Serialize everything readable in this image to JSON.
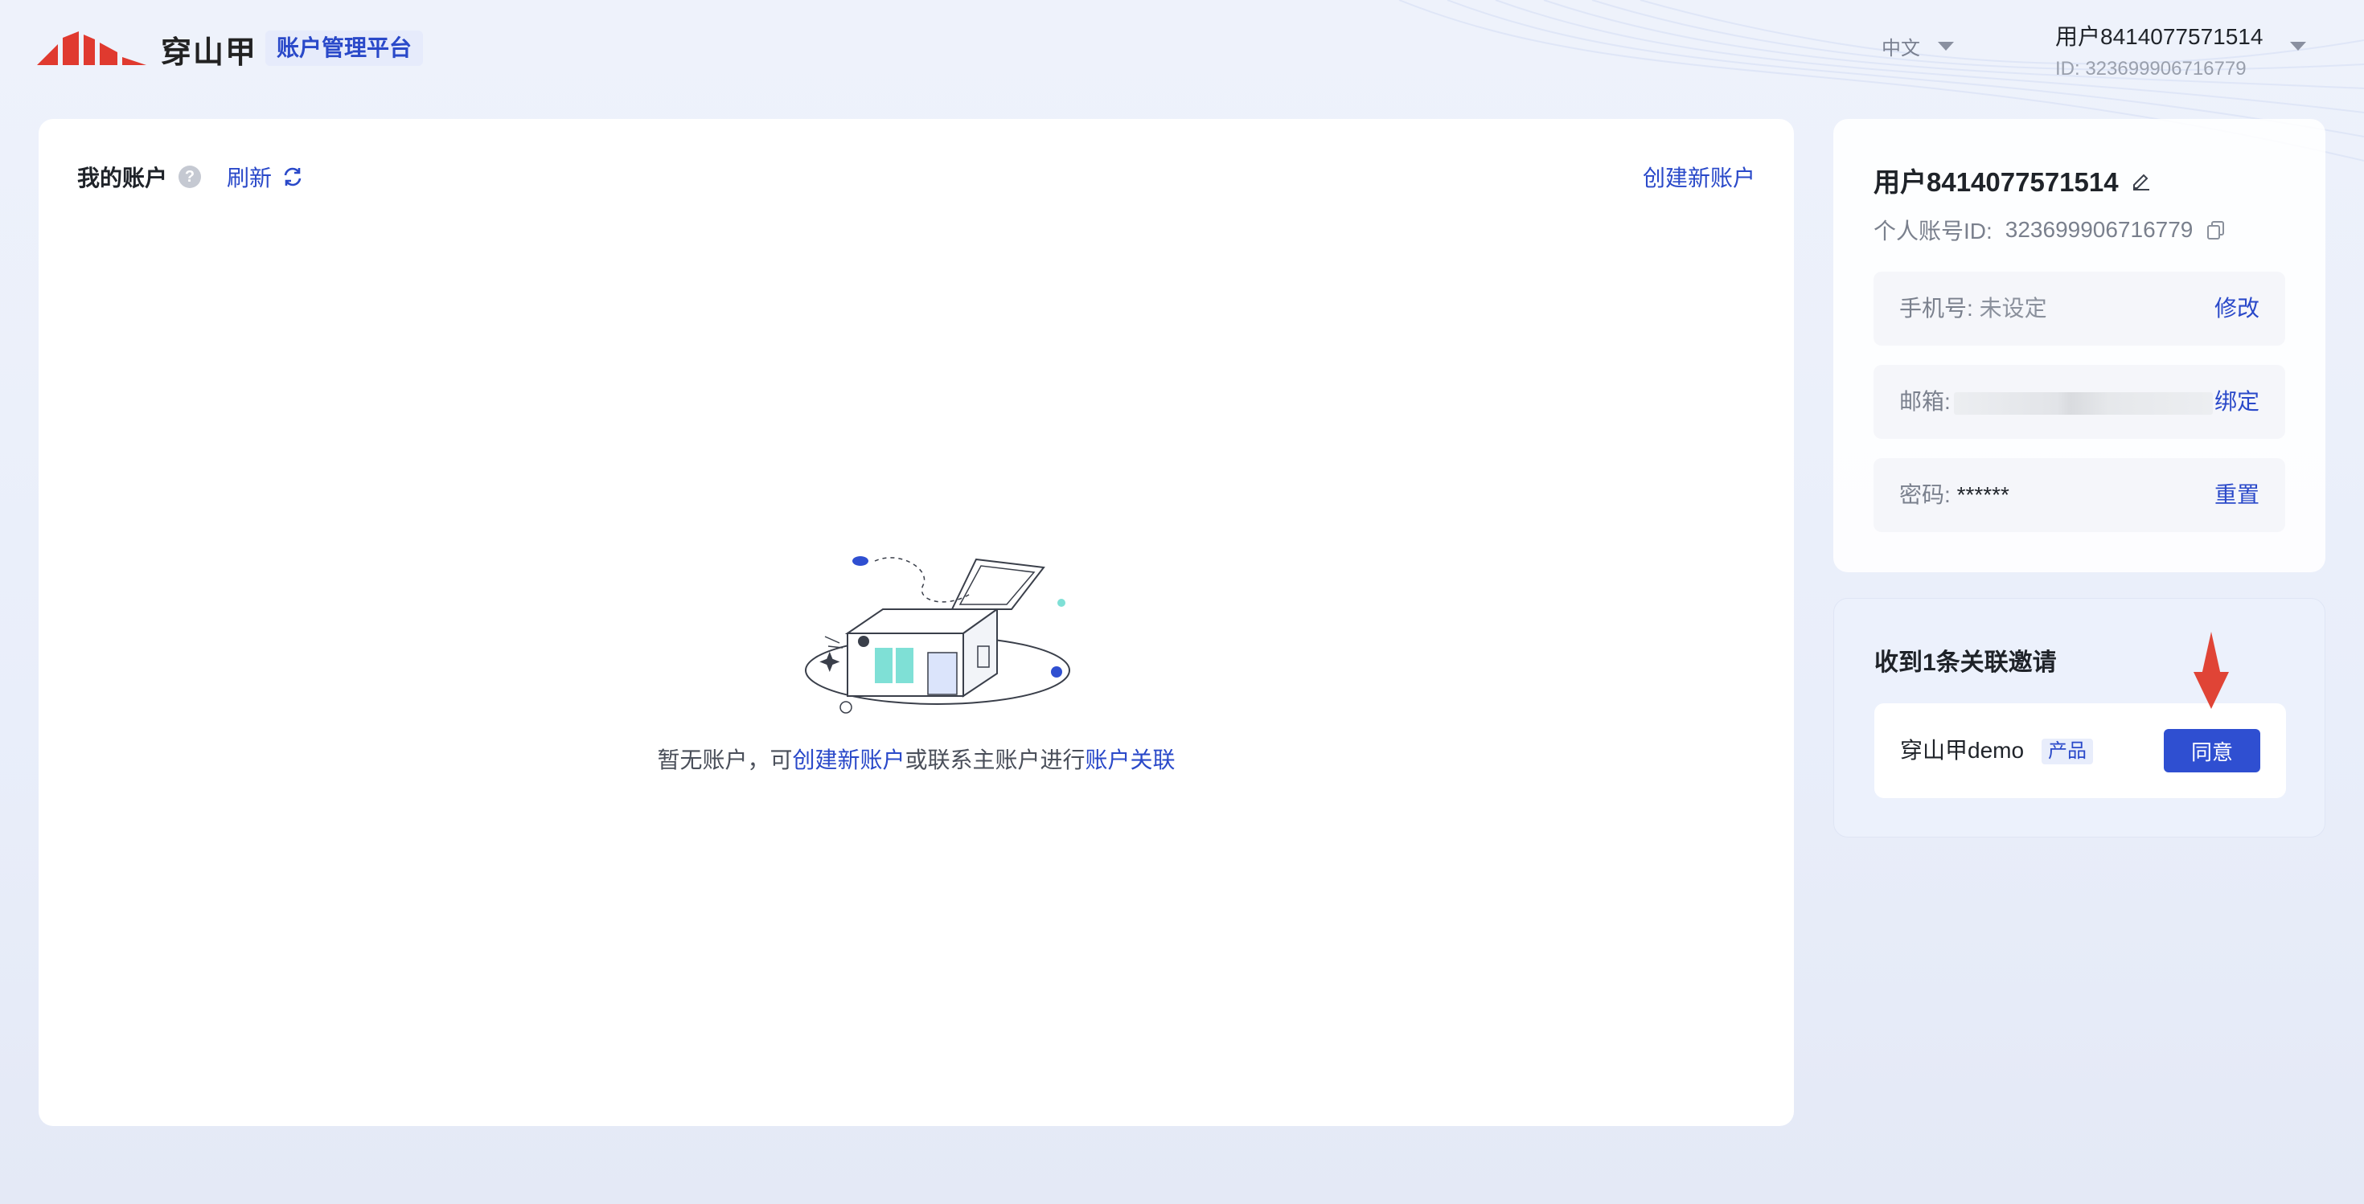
{
  "header": {
    "logo_text": "穿山甲",
    "platform_name": "账户管理平台",
    "language": "中文",
    "user_name": "用户8414077571514",
    "user_id_line": "ID: 323699906716779"
  },
  "accounts": {
    "title": "我的账户",
    "refresh_label": "刷新",
    "create_label": "创建新账户",
    "empty_prefix": "暂无账户，可",
    "empty_link1": "创建新账户",
    "empty_middle": "或联系主账户进行",
    "empty_link2": "账户关联"
  },
  "profile": {
    "user_name": "用户8414077571514",
    "account_id_label": "个人账号ID:",
    "account_id": "323699906716779",
    "phone_label": "手机号:",
    "phone_value": "未设定",
    "phone_action": "修改",
    "email_label": "邮箱:",
    "email_action": "绑定",
    "password_label": "密码:",
    "password_value": "******",
    "password_action": "重置"
  },
  "invitations": {
    "title": "收到1条关联邀请",
    "items": [
      {
        "name": "穿山甲demo",
        "tag": "产品",
        "action": "同意"
      }
    ]
  },
  "colors": {
    "accent": "#2f4fd1",
    "link": "#2a49c9",
    "logo_red": "#e03a2f",
    "arrow_red": "#e04436"
  },
  "icons": [
    "logo-icon",
    "caret-down-icon",
    "help-icon",
    "refresh-icon",
    "edit-icon",
    "copy-icon",
    "empty-box-illustration",
    "arrow-down-icon"
  ]
}
